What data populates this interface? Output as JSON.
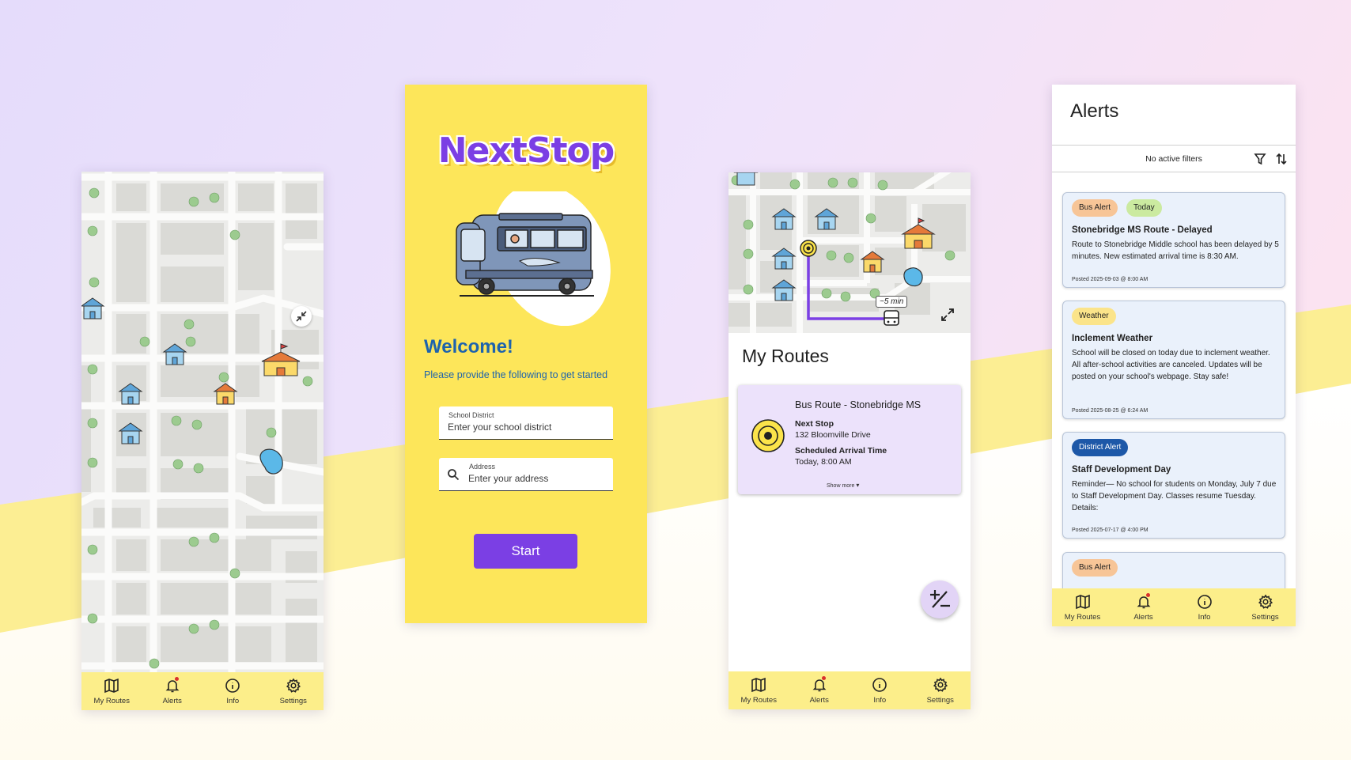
{
  "app": {
    "name": "NextStop"
  },
  "colors": {
    "purple": "#7b3fe4",
    "yellow": "#fde65a",
    "nav_yellow": "#fcee8a",
    "blue_text": "#1d63ad",
    "route_card": "#ece2fb",
    "alert_card": "#eaf1fb"
  },
  "nav": {
    "my_routes": "My Routes",
    "alerts": "Alerts",
    "info": "Info",
    "settings": "Settings"
  },
  "welcome": {
    "title": "Welcome!",
    "subtitle": "Please provide the following to get started",
    "district_label": "School District",
    "district_placeholder": "Enter your school district",
    "address_label": "Address",
    "address_placeholder": "Enter your address",
    "start_button": "Start"
  },
  "routes": {
    "title": "My Routes",
    "eta": "~5 min",
    "card": {
      "title": "Bus Route - Stonebridge MS",
      "next_stop_label": "Next Stop",
      "next_stop_value": "132 Bloomville Drive",
      "arrival_label": "Scheduled Arrival Time",
      "arrival_value": "Today, 8:00 AM",
      "show_more": "Show more"
    }
  },
  "alerts": {
    "title": "Alerts",
    "filter_status": "No active filters",
    "items": [
      {
        "tags": [
          "Bus Alert",
          "Today"
        ],
        "title": "Stonebridge MS Route - Delayed",
        "body": "Route to Stonebridge Middle school has been delayed by 5 minutes. New estimated arrival time is 8:30 AM.",
        "posted": "Posted 2025-09-03 @ 8:00 AM"
      },
      {
        "tags": [
          "Weather"
        ],
        "title": "Inclement Weather",
        "body": "School will be closed on today due to inclement weather. All after-school activities are canceled. Updates will be posted on your school's webpage. Stay safe!",
        "posted": "Posted 2025-08-25 @ 6:24 AM"
      },
      {
        "tags": [
          "District Alert"
        ],
        "title": "Staff Development Day",
        "body": "Reminder— No school for students on Monday, July 7 due to Staff Development Day. Classes resume Tuesday. Details:",
        "posted": "Posted 2025-07-17 @ 4:00 PM"
      },
      {
        "tags": [
          "Bus Alert"
        ]
      }
    ]
  }
}
